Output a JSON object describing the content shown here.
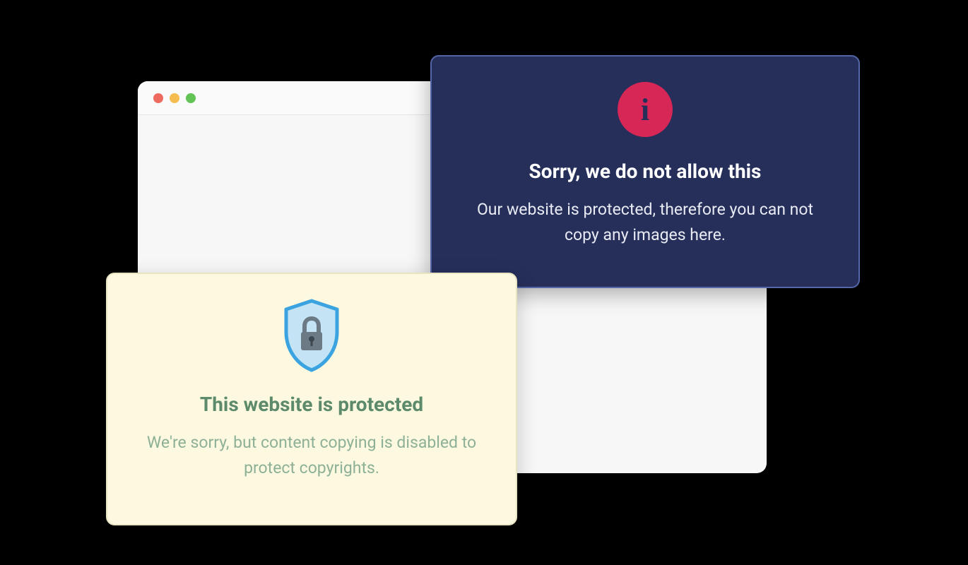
{
  "darkModal": {
    "title": "Sorry, we do not allow this",
    "body": "Our website is protected, therefore you can not copy any images here."
  },
  "lightModal": {
    "title": "This website is protected",
    "body": "We're sorry, but content copying is disabled to protect copyrights."
  }
}
